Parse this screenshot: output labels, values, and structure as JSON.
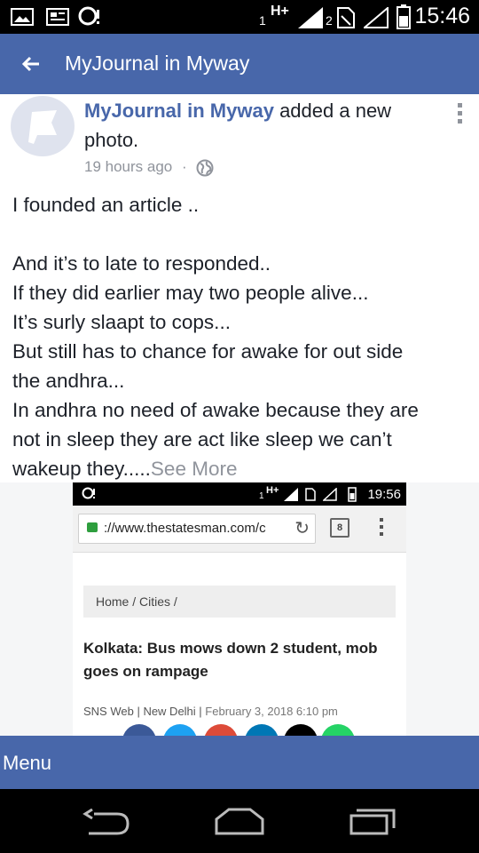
{
  "status_bar": {
    "time": "15:46",
    "sim1_label": "1",
    "network_type": "H+",
    "sim2_label": "2",
    "icons": [
      "image-icon",
      "notification-icon",
      "alert-icon",
      "signal-icon",
      "signal-icon",
      "no-sim-icon",
      "battery-icon"
    ]
  },
  "app_bar": {
    "back_icon": "arrow-left-icon",
    "title": "MyJournal in Myway"
  },
  "post": {
    "author": "MyJournal in Myway",
    "action": " added a new photo.",
    "timestamp": "19 hours ago",
    "separator": "·",
    "privacy_icon": "globe-icon",
    "options_icon": "more-vertical-icon",
    "body_lines": [
      "I founded an article ..",
      "",
      "And it’s to late to responded..",
      "If they did earlier may two people alive...",
      "It’s surly slaapt to cops...",
      "But still has to chance for awake for out side",
      "the andhra...",
      "In andhra no need of awake because they are",
      "not in sleep they are act like sleep we can’t"
    ],
    "last_line": "wakeup they.....",
    "see_more": "See More"
  },
  "photo": {
    "status_time": "19:56",
    "status_sim1": "1",
    "status_network": "H+",
    "url": "://www.thestatesman.com/c",
    "tab_count": "8",
    "breadcrumb": "Home / Cities /",
    "headline": "Kolkata: Bus mows down 2 student, mob goes on rampage",
    "byline_source": "SNS Web | New Delhi |",
    "byline_date": "February 3, 2018 6:10 pm",
    "share_colors": [
      "#3b5998",
      "#1da1f2",
      "#dd4b39",
      "#0077b5",
      "#000000",
      "#25d366"
    ]
  },
  "menu_bar": {
    "label": "Menu"
  },
  "nav_bar": {
    "icons": [
      "back-icon",
      "home-icon",
      "recent-apps-icon"
    ]
  }
}
